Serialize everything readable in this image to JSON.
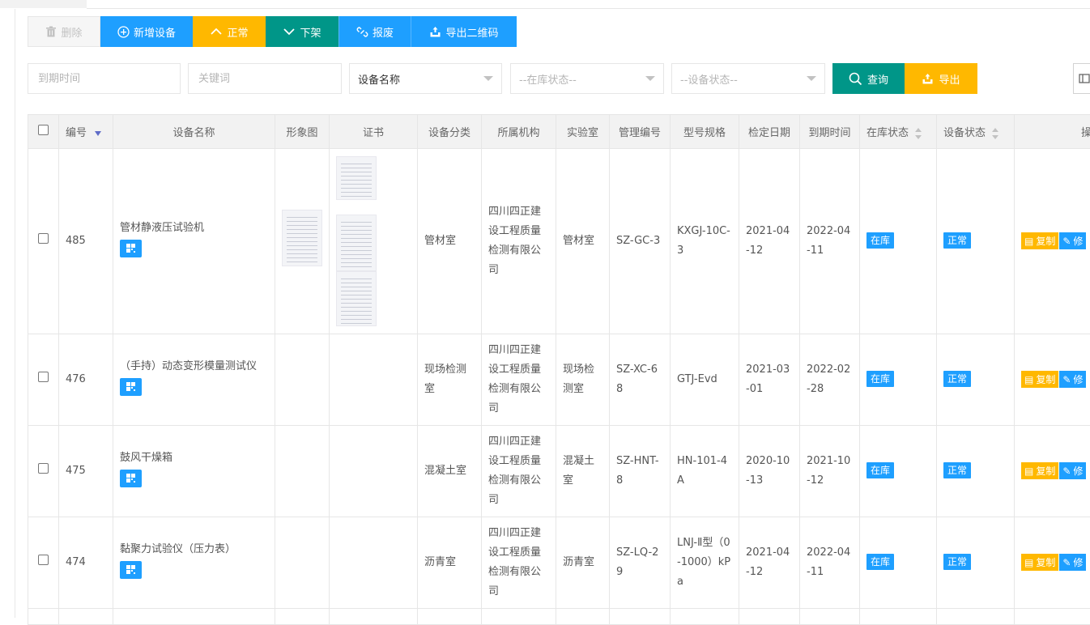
{
  "toolbar": {
    "delete_label": "删除",
    "add_label": "新增设备",
    "normal_label": "正常",
    "off_shelf_label": "下架",
    "scrap_label": "报废",
    "export_qr_label": "导出二维码"
  },
  "filters": {
    "expire_placeholder": "到期时间",
    "keyword_placeholder": "关键词",
    "device_name_value": "设备名称",
    "stock_status_placeholder": "--在库状态--",
    "device_status_placeholder": "--设备状态--",
    "query_label": "查询",
    "export_label": "导出"
  },
  "table": {
    "headers": {
      "id": "编号",
      "name": "设备名称",
      "image": "形象图",
      "cert": "证书",
      "category": "设备分类",
      "org": "所属机构",
      "lab": "实验室",
      "mgmt_no": "管理编号",
      "model": "型号规格",
      "check_date": "检定日期",
      "expire_date": "到期时间",
      "stock_status": "在库状态",
      "device_status": "设备状态",
      "ops": "操作"
    },
    "rows": [
      {
        "id": "485",
        "name": "管材静液压试验机",
        "category": "管材室",
        "org": "四川四正建设工程质量检测有限公司",
        "lab": "管材室",
        "mgmt_no": "SZ-GC-3",
        "model": "KXGJ-10C-3",
        "check_date": "2021-04-12",
        "expire_date": "2022-04-11",
        "stock_status": "在库",
        "device_status": "正常",
        "copy_label": "复制",
        "edit_label": "修"
      },
      {
        "id": "476",
        "name": "（手持）动态变形模量测试仪",
        "category": "现场检测室",
        "org": "四川四正建设工程质量检测有限公司",
        "lab": "现场检测室",
        "mgmt_no": "SZ-XC-68",
        "model": "GTJ-Evd",
        "check_date": "2021-03-01",
        "expire_date": "2022-02-28",
        "stock_status": "在库",
        "device_status": "正常",
        "copy_label": "复制",
        "edit_label": "修"
      },
      {
        "id": "475",
        "name": "鼓风干燥箱",
        "category": "混凝土室",
        "org": "四川四正建设工程质量检测有限公司",
        "lab": "混凝土室",
        "mgmt_no": "SZ-HNT-8",
        "model": "HN-101-4A",
        "check_date": "2020-10-13",
        "expire_date": "2021-10-12",
        "stock_status": "在库",
        "device_status": "正常",
        "copy_label": "复制",
        "edit_label": "修"
      },
      {
        "id": "474",
        "name": "黏聚力试验仪（压力表）",
        "category": "沥青室",
        "org": "四川四正建设工程质量检测有限公司",
        "lab": "沥青室",
        "mgmt_no": "SZ-LQ-29",
        "model": "LNJ-Ⅱ型（0-1000）kPa",
        "check_date": "2021-04-12",
        "expire_date": "2022-04-11",
        "stock_status": "在库",
        "device_status": "正常",
        "copy_label": "复制",
        "edit_label": "修"
      }
    ]
  },
  "colors": {
    "blue": "#1e9fff",
    "teal": "#009688",
    "orange": "#ffb800"
  }
}
